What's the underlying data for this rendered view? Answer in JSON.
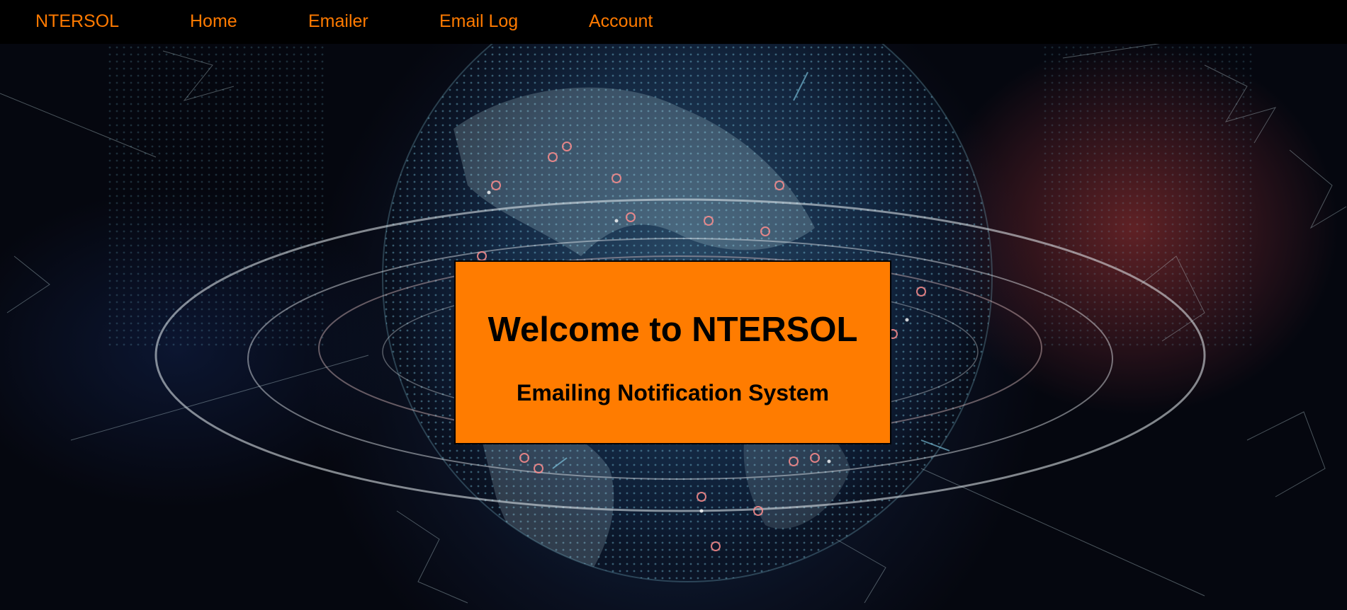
{
  "nav": {
    "brand": "NTERSOL",
    "items": [
      {
        "label": "Home"
      },
      {
        "label": "Emailer"
      },
      {
        "label": "Email Log"
      },
      {
        "label": "Account"
      }
    ]
  },
  "hero": {
    "background": "digital-globe-network-image",
    "title": "Welcome to NTERSOL",
    "subtitle": "Emailing Notification System"
  },
  "colors": {
    "accent": "#ff7a00",
    "navbar": "#000000",
    "box_text": "#000000"
  }
}
